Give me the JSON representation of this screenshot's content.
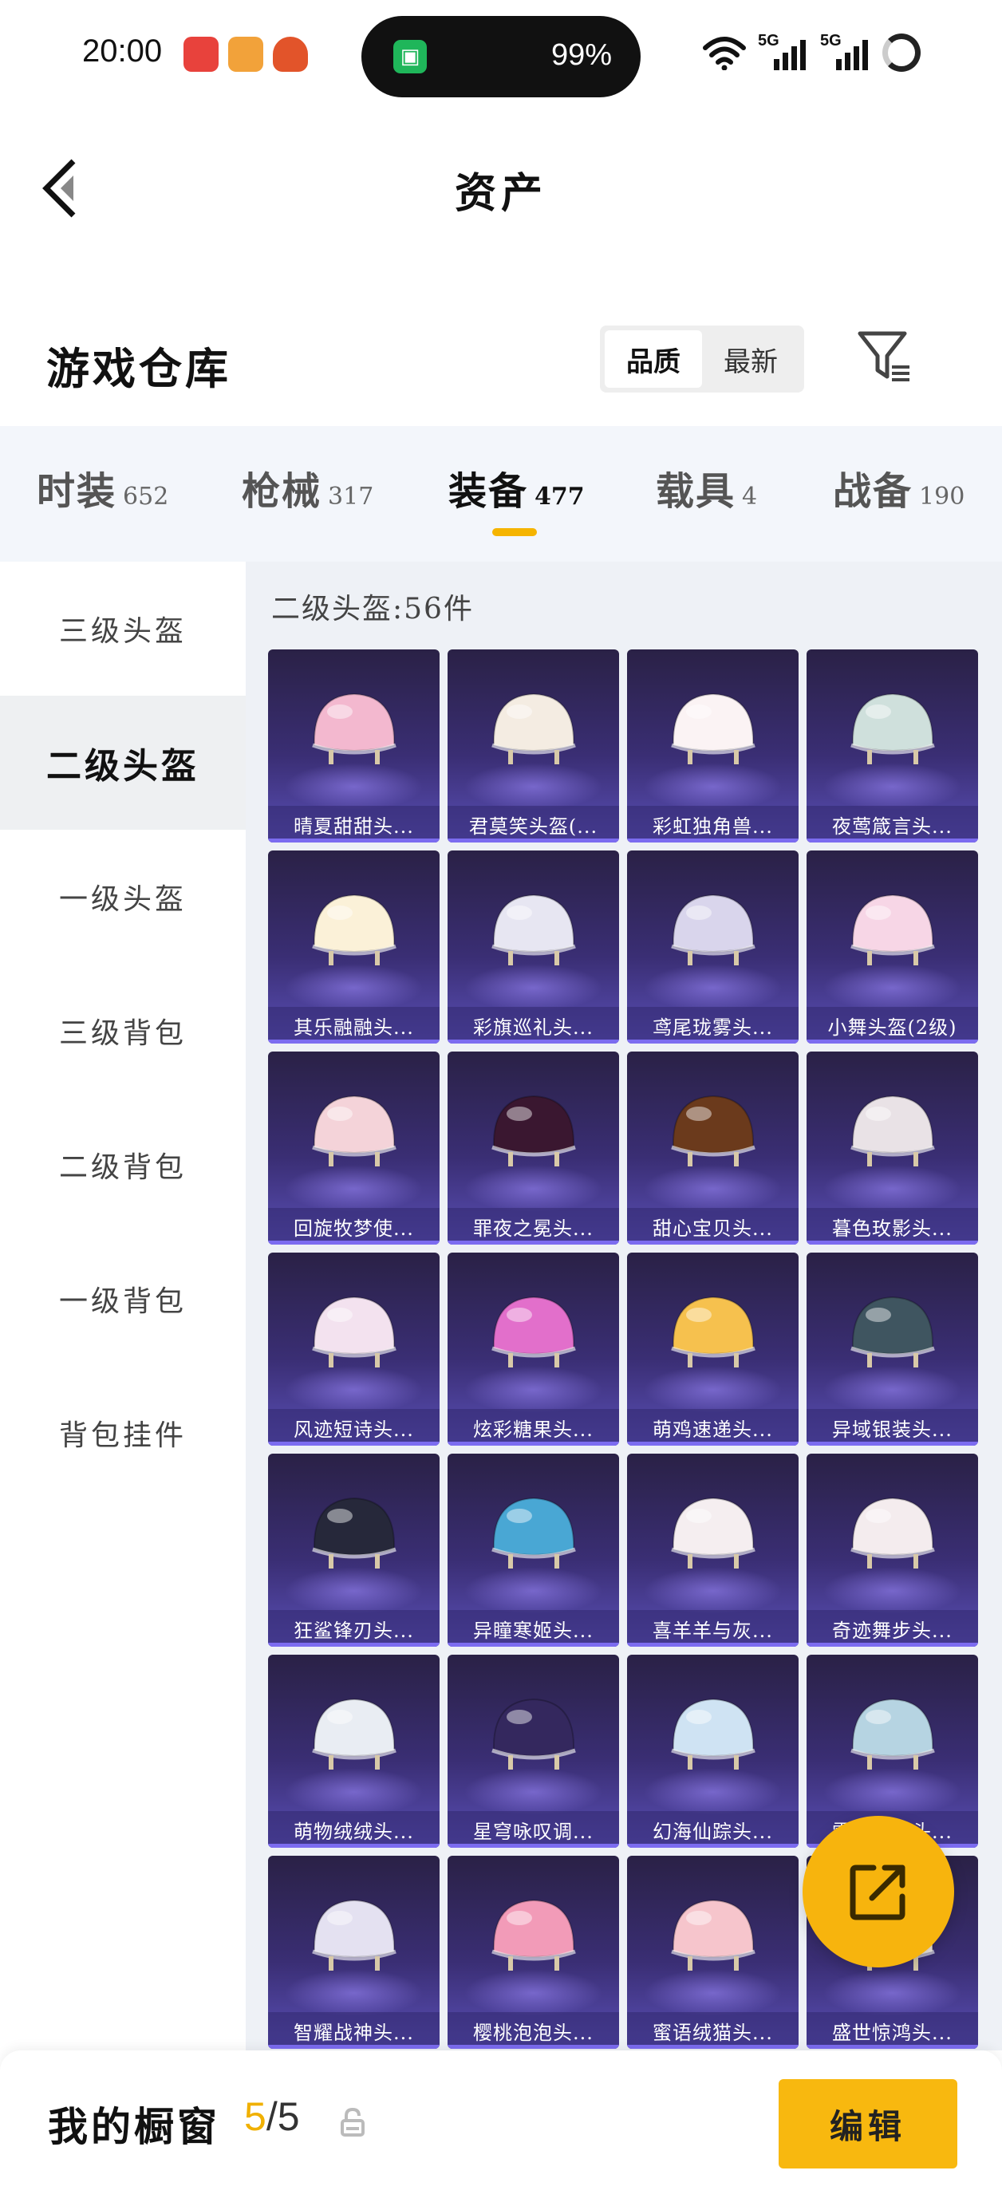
{
  "status_bar": {
    "time": "20:00",
    "battery": "99%",
    "signal_1": "5G",
    "signal_2": "5G"
  },
  "header": {
    "title": "资产"
  },
  "warehouse": {
    "title": "游戏仓库",
    "sort_options": [
      "品质",
      "最新"
    ],
    "active_sort": "品质"
  },
  "tabs": [
    {
      "label": "时装",
      "count": "652"
    },
    {
      "label": "枪械",
      "count": "317"
    },
    {
      "label": "装备",
      "count": "477"
    },
    {
      "label": "载具",
      "count": "4"
    },
    {
      "label": "战备",
      "count": "190"
    }
  ],
  "active_tab": "装备",
  "accent_color": "#f5b400",
  "sidebar": {
    "items": [
      "三级头盔",
      "二级头盔",
      "一级头盔",
      "三级背包",
      "二级背包",
      "一级背包",
      "背包挂件"
    ],
    "active": "二级头盔"
  },
  "content": {
    "count_line": "二级头盔:56件",
    "items": [
      {
        "name": "晴夏甜甜头...",
        "color": "#f3b8cf",
        "icon": "helmet-icon"
      },
      {
        "name": "君莫笑头盔(...",
        "color": "#f4ece2",
        "icon": "helmet-icon"
      },
      {
        "name": "彩虹独角兽...",
        "color": "#fbf3f4",
        "icon": "helmet-icon"
      },
      {
        "name": "夜莺箴言头...",
        "color": "#cfe0dc",
        "icon": "helmet-icon"
      },
      {
        "name": "其乐融融头...",
        "color": "#fbf1d8",
        "icon": "helmet-icon"
      },
      {
        "name": "彩旗巡礼头...",
        "color": "#e7e6f2",
        "icon": "helmet-icon"
      },
      {
        "name": "鸢尾珑雾头...",
        "color": "#d9d5ec",
        "icon": "helmet-icon"
      },
      {
        "name": "小舞头盔(2级)",
        "color": "#f7d6e6",
        "icon": "helmet-icon"
      },
      {
        "name": "回旋牧梦使...",
        "color": "#f4d3d9",
        "icon": "helmet-icon"
      },
      {
        "name": "罪夜之冕头...",
        "color": "#3a1730",
        "icon": "helmet-icon"
      },
      {
        "name": "甜心宝贝头...",
        "color": "#6b3a1c",
        "icon": "helmet-icon"
      },
      {
        "name": "暮色玫影头...",
        "color": "#e9e2e6",
        "icon": "helmet-icon"
      },
      {
        "name": "风迹短诗头...",
        "color": "#f3e2ef",
        "icon": "helmet-icon"
      },
      {
        "name": "炫彩糖果头...",
        "color": "#e26fcb",
        "icon": "helmet-icon"
      },
      {
        "name": "萌鸡速递头...",
        "color": "#f6c14e",
        "icon": "helmet-icon"
      },
      {
        "name": "异域银装头...",
        "color": "#3f5560",
        "icon": "helmet-icon"
      },
      {
        "name": "狂鲨锋刃头...",
        "color": "#26283a",
        "icon": "helmet-icon"
      },
      {
        "name": "异瞳寒姬头...",
        "color": "#49a7d4",
        "icon": "helmet-icon"
      },
      {
        "name": "喜羊羊与灰...",
        "color": "#f5eef0",
        "icon": "helmet-icon"
      },
      {
        "name": "奇迹舞步头...",
        "color": "#f4ecee",
        "icon": "helmet-icon"
      },
      {
        "name": "萌物绒绒头...",
        "color": "#e9edf3",
        "icon": "helmet-icon"
      },
      {
        "name": "星穹咏叹调...",
        "color": "#34285e",
        "icon": "helmet-icon"
      },
      {
        "name": "幻海仙踪头...",
        "color": "#cfe3f3",
        "icon": "helmet-icon"
      },
      {
        "name": "雪月…产头...",
        "color": "#b6d4e2",
        "icon": "helmet-icon"
      },
      {
        "name": "智耀战神头...",
        "color": "#e4e1f1",
        "icon": "helmet-icon"
      },
      {
        "name": "樱桃泡泡头...",
        "color": "#f29bb8",
        "icon": "helmet-icon"
      },
      {
        "name": "蜜语绒猫头...",
        "color": "#f6c5cc",
        "icon": "helmet-icon"
      },
      {
        "name": "盛世惊鸿头...",
        "color": "#f1e6e0",
        "icon": "helmet-icon"
      }
    ]
  },
  "showcase": {
    "label": "我的橱窗",
    "used": "5",
    "total": "/5",
    "edit_label": "编辑"
  }
}
